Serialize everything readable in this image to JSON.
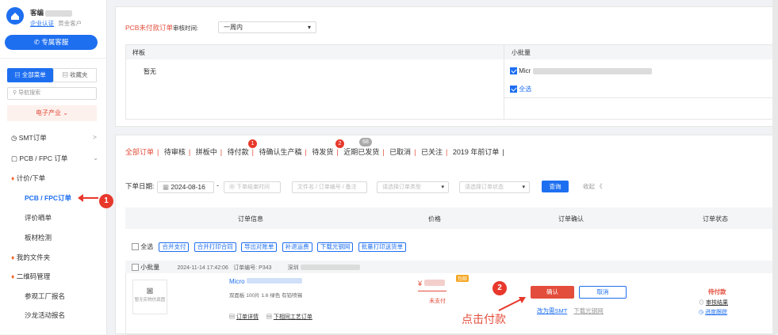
{
  "user": {
    "name": "客编",
    "cert_link": "企业认证",
    "level": "黄金客户",
    "service_button": "专属客服"
  },
  "sidebar": {
    "tabs": [
      "全部菜单",
      "收藏夹"
    ],
    "search_placeholder": "导航搜索",
    "industry": "电子产业",
    "items": [
      {
        "label": "SMT订单",
        "arrow": ">"
      },
      {
        "label": "PCB / FPC 订单",
        "arrow": "v"
      },
      {
        "label": "计价/下单"
      },
      {
        "label": "PCB / FPC订单"
      },
      {
        "label": "评价晒单"
      },
      {
        "label": "板材检测"
      },
      {
        "label": "我的文件夹"
      },
      {
        "label": "二维码管理"
      },
      {
        "label": "参观工厂报名"
      },
      {
        "label": "沙龙活动报名"
      }
    ]
  },
  "unpaid_panel": {
    "title": "PCB未付款订单",
    "review_label": "审核时间:",
    "review_value": "一周内",
    "sample_header": "样板",
    "sample_empty": "暂无",
    "batch_header": "小批量",
    "batch_item": "Micr",
    "select_all": "全选"
  },
  "tabs": {
    "items": [
      "全部订单",
      "待审核",
      "拼板中",
      "待付款",
      "待确认生产稿",
      "待发货",
      "近期已发货",
      "已取消",
      "已关注",
      "2019 年前订单"
    ],
    "badge_pay": "1",
    "badge_ship": "2",
    "badge_shipped": "68"
  },
  "filter": {
    "date_label": "下单日期:",
    "date_from": "2024-08-16",
    "date_to_placeholder": "下单结束时间",
    "file_placeholder": "文件名 / 订单编号 / 备注",
    "type_placeholder": "请选择订单类型",
    "status_placeholder": "请选择订单状态",
    "query_button": "查询",
    "collapse": "收起 《"
  },
  "table": {
    "headers": [
      "订单信息",
      "价格",
      "订单确认",
      "订单状态"
    ],
    "select_all": "全选",
    "actions": [
      "合并支付",
      "合并打印合同",
      "导出对账单",
      "补退运费",
      "下载光钢网",
      "批量打印送货单"
    ]
  },
  "order": {
    "type": "小批量",
    "time": "2024-11-14 17:42:06",
    "number_label": "订单编号: P343",
    "city": "深圳",
    "no_image": "暂无实物仿真图",
    "name": "Micro",
    "specs": "双面板  100片  1.6  绿色  有铅喷锡",
    "detail_link": "订单详情",
    "same_process": "下相同工艺订单",
    "price_prefix": "¥",
    "free_ship": "包邮",
    "unpaid": "未支付",
    "confirm_button": "确认",
    "cancel_button": "取消",
    "change_smt": "改为需SMT",
    "download_stencil": "下载光钢网",
    "status": "待付款",
    "review_result": "审核结果",
    "progress": "进度跟踪"
  },
  "annotations": {
    "one": "1",
    "two": "2",
    "hint": "点击付款"
  },
  "colors": {
    "accent": "#1e6ff0",
    "red": "#e8382c"
  }
}
